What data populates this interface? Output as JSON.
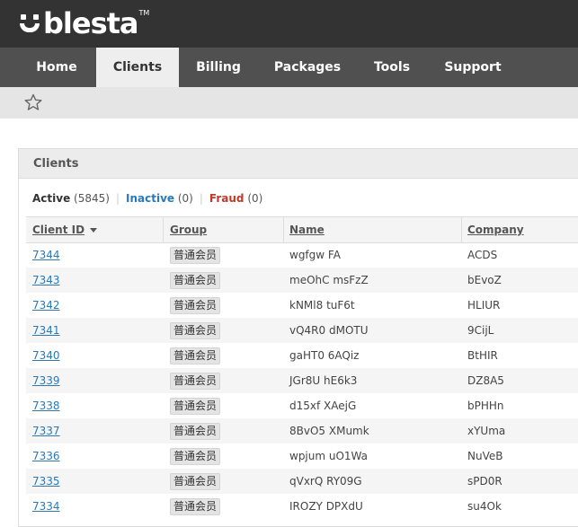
{
  "brand": {
    "logo_text": "blesta",
    "trademark": "TM"
  },
  "nav": {
    "items": [
      {
        "label": "Home"
      },
      {
        "label": "Clients"
      },
      {
        "label": "Billing"
      },
      {
        "label": "Packages"
      },
      {
        "label": "Tools"
      },
      {
        "label": "Support"
      }
    ],
    "active": "Clients"
  },
  "panel": {
    "title": "Clients",
    "filters": {
      "active": {
        "label": "Active",
        "count": "(5845)"
      },
      "inactive": {
        "label": "Inactive",
        "count": "(0)"
      },
      "fraud": {
        "label": "Fraud",
        "count": "(0)"
      }
    }
  },
  "table": {
    "headers": {
      "client_id": "Client ID",
      "group": "Group",
      "name": "Name",
      "company": "Company"
    },
    "rows": [
      {
        "id": "7344",
        "group": "普通会员",
        "name": "wgfgw FA",
        "company": "ACDS"
      },
      {
        "id": "7343",
        "group": "普通会员",
        "name": "meOhC msFzZ",
        "company": "bEvoZ"
      },
      {
        "id": "7342",
        "group": "普通会员",
        "name": "kNMl8 tuF6t",
        "company": "HLIUR"
      },
      {
        "id": "7341",
        "group": "普通会员",
        "name": "vQ4R0 dMOTU",
        "company": "9CijL"
      },
      {
        "id": "7340",
        "group": "普通会员",
        "name": "gaHT0 6AQiz",
        "company": "BtHIR"
      },
      {
        "id": "7339",
        "group": "普通会员",
        "name": "JGr8U hE6k3",
        "company": "DZ8A5"
      },
      {
        "id": "7338",
        "group": "普通会员",
        "name": "d15xf XAejG",
        "company": "bPHHn"
      },
      {
        "id": "7337",
        "group": "普通会员",
        "name": "8BvO5 XMumk",
        "company": "xYUma"
      },
      {
        "id": "7336",
        "group": "普通会员",
        "name": "wpjum uO1Wa",
        "company": "NuVeB"
      },
      {
        "id": "7335",
        "group": "普通会员",
        "name": "qVxrQ RY09G",
        "company": "sPD0R"
      },
      {
        "id": "7334",
        "group": "普通会员",
        "name": "IROZY DPXdU",
        "company": "su4Ok"
      }
    ]
  },
  "colors": {
    "topbar": "#333333",
    "navbar": "#505050",
    "link": "#2a79b7",
    "fraud": "#c0392b"
  },
  "icons": {
    "favorite": "star-outline-icon",
    "sort": "caret-down-icon"
  }
}
